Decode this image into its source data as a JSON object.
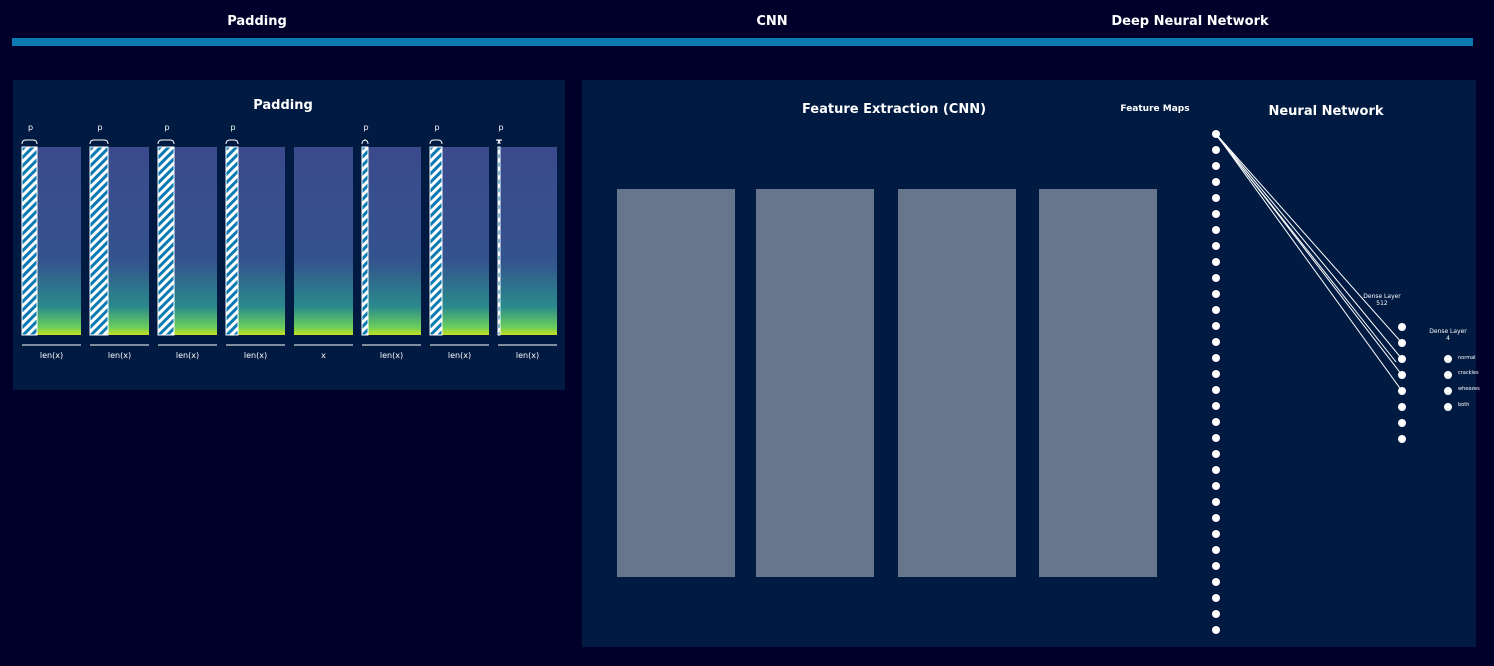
{
  "nav": {
    "tabs": [
      "Padding",
      "CNN",
      "Deep Neural Network"
    ]
  },
  "padding_panel": {
    "title": "Padding",
    "pad_marker": "p",
    "columns": [
      {
        "pad_label": "p",
        "len_label": "len(x)",
        "pad_fraction": 0.25
      },
      {
        "pad_label": "p",
        "len_label": "len(x)",
        "pad_fraction": 0.3
      },
      {
        "pad_label": "p",
        "len_label": "len(x)",
        "pad_fraction": 0.27
      },
      {
        "pad_label": "p",
        "len_label": "len(x)",
        "pad_fraction": 0.21
      },
      {
        "pad_label": "",
        "len_label": "x",
        "pad_fraction": 0.0
      },
      {
        "pad_label": "p",
        "len_label": "len(x)",
        "pad_fraction": 0.1
      },
      {
        "pad_label": "p",
        "len_label": "len(x)",
        "pad_fraction": 0.21
      },
      {
        "pad_label": "p",
        "len_label": "len(x)",
        "pad_fraction": 0.03
      }
    ]
  },
  "cnn_panel": {
    "title": "Feature Extraction (CNN)",
    "feature_maps_label": "Feature Maps",
    "nn_title": "Neural Network",
    "map_count": 4,
    "input_nodes": 32,
    "dense1": {
      "label": "Dense Layer",
      "units": "512",
      "nodes": 8
    },
    "dense2": {
      "label": "Dense Layer",
      "units": "4",
      "outputs": [
        "normal",
        "crackles",
        "wheezes",
        "both"
      ]
    }
  },
  "colors": {
    "background": "#00002a",
    "panel": "#001a42",
    "accent": "#0b79b2",
    "feature_map": "#67768c",
    "spectrogram_low": "#3b4a8c",
    "spectrogram_high": "#c8e020"
  }
}
